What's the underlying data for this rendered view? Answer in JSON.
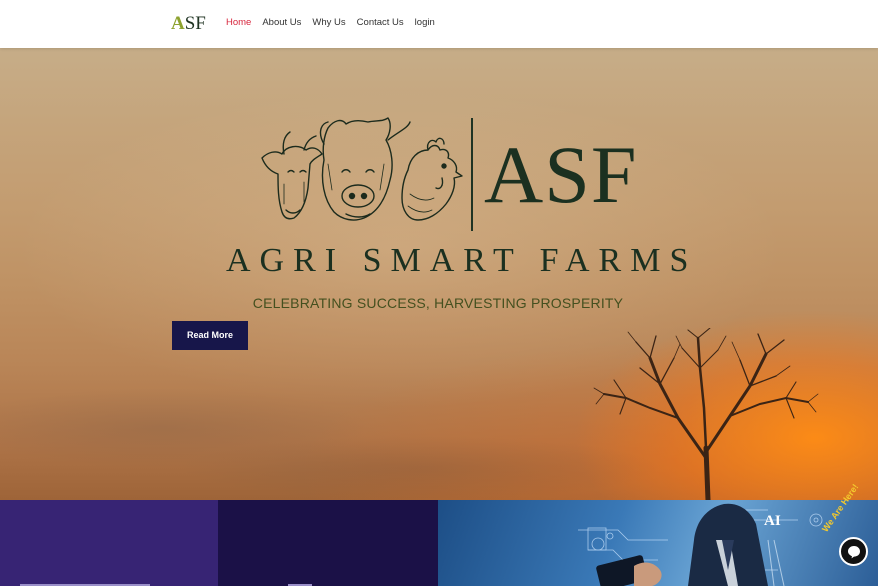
{
  "brand": {
    "logo_initial": "A",
    "logo_rest": "SF"
  },
  "nav": {
    "items": [
      {
        "label": "Home",
        "active": true
      },
      {
        "label": "About Us",
        "active": false
      },
      {
        "label": "Why Us",
        "active": false
      },
      {
        "label": "Contact Us",
        "active": false
      },
      {
        "label": "login",
        "active": false
      }
    ]
  },
  "hero": {
    "logo_mark": "ASF",
    "logo_name": "AGRI SMART FARMS",
    "tagline": "CELEBRATING SUCCESS, HARVESTING PROSPERITY",
    "cta_label": "Read More",
    "logo_art_icon": "cow-pig-rooster-logo-icon",
    "tree_icon": "tree-silhouette-icon"
  },
  "feature_strip": {
    "ai_label": "AI",
    "chat_widget_label": "We Are Here!",
    "chat_icon": "chat-bubble-icon"
  },
  "colors": {
    "nav_active": "#d7263d",
    "brand_accent": "#8da22e",
    "cta_background": "#17164a",
    "logo_ink": "#1b3020",
    "tagline": "#44501f",
    "panel_purple": "#372474",
    "panel_navy": "#1b1147"
  }
}
